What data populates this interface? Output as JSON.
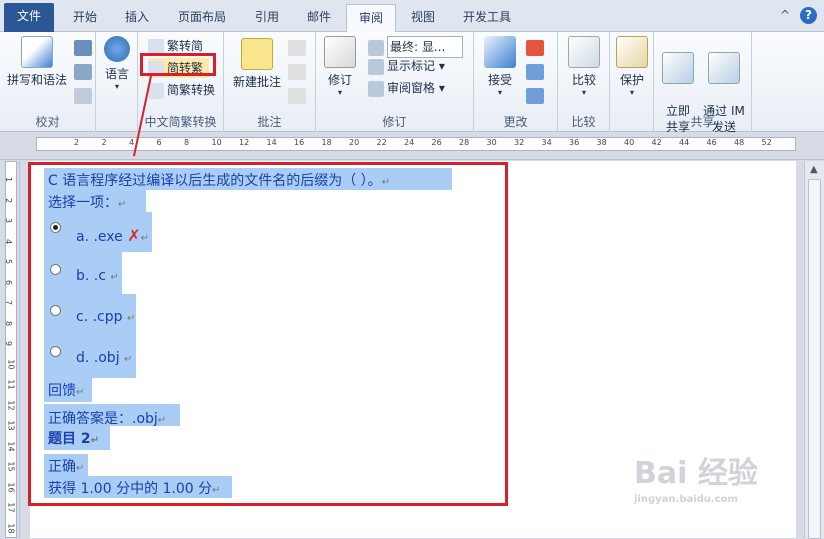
{
  "tabs": [
    "文件",
    "开始",
    "插入",
    "页面布局",
    "引用",
    "邮件",
    "审阅",
    "视图",
    "开发工具"
  ],
  "active_tab": "审阅",
  "window_controls": {
    "collapse": "^",
    "help": "?"
  },
  "ribbon": {
    "proofing": {
      "label": "校对",
      "spelling": "拼写和语法"
    },
    "language": {
      "label": "语言"
    },
    "chinese_conversion": {
      "label": "中文简繁转换",
      "to_simplified": "繁转简",
      "to_traditional": "简转繁",
      "conversion": "简繁转换"
    },
    "comments": {
      "label": "批注",
      "new_comment": "新建批注"
    },
    "tracking": {
      "label": "修订",
      "track_changes": "修订",
      "display_mode": "最终: 显...",
      "show_markup": "显示标记",
      "review_pane": "审阅窗格"
    },
    "changes": {
      "label": "更改",
      "accept": "接受"
    },
    "compare": {
      "label": "比较",
      "compare_btn": "比较"
    },
    "protect": {
      "label": "",
      "protect_btn": "保护"
    },
    "share": {
      "label": "共享",
      "share_now": "立即\n共享",
      "send_im": "通过 IM\n发送"
    }
  },
  "ruler_numbers": [
    "2",
    "2",
    "4",
    "6",
    "8",
    "10",
    "12",
    "14",
    "16",
    "18",
    "20",
    "22",
    "24",
    "26",
    "28",
    "30",
    "32",
    "34",
    "36",
    "38",
    "40",
    "42",
    "44",
    "46",
    "48",
    "52"
  ],
  "vruler_numbers": [
    "1",
    "2",
    "3",
    "4",
    "5",
    "6",
    "7",
    "8",
    "9",
    "10",
    "11",
    "12",
    "13",
    "14",
    "15",
    "16",
    "17",
    "18"
  ],
  "document": {
    "question": "C 语言程序经过编译以后生成的文件名的后缀为（  ）。",
    "prompt": "选择一项：",
    "options": [
      {
        "text": "a. .exe",
        "selected": true,
        "mark": "✗"
      },
      {
        "text": "b. .c",
        "selected": false,
        "mark": ""
      },
      {
        "text": "c. .cpp",
        "selected": false,
        "mark": ""
      },
      {
        "text": "d. .obj",
        "selected": false,
        "mark": ""
      }
    ],
    "feedback": "回馈",
    "answer": "正确答案是：.obj",
    "title2": "题目 2",
    "status": "正确",
    "score": "获得 1.00 分中的 1.00 分",
    "para_mark": "↵"
  },
  "watermark": {
    "logo": "Bai 经验",
    "url": "jingyan.baidu.com"
  }
}
